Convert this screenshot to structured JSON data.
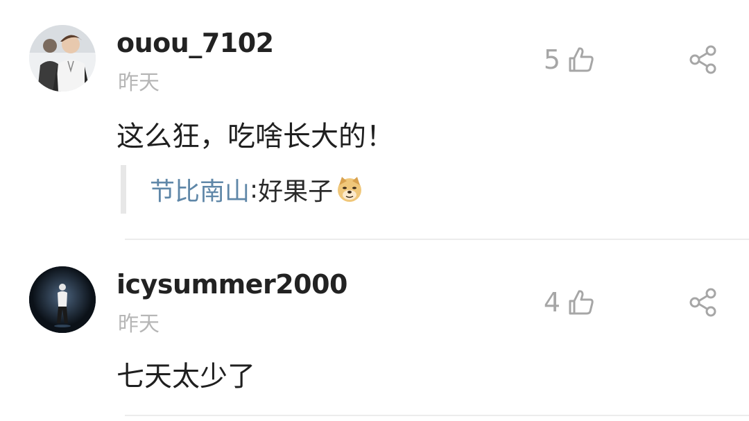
{
  "comments": [
    {
      "username": "ouou_7102",
      "time": "昨天",
      "likes": "5",
      "content": "这么狂，吃啥长大的！",
      "reply": {
        "user": "节比南山",
        "separator": ":",
        "text": "好果子"
      },
      "icons": {
        "like": "thumbs-up-icon",
        "share": "share-icon",
        "emoji": "doge-emoji-icon"
      }
    },
    {
      "username": "icysummer2000",
      "time": "昨天",
      "likes": "4",
      "content": "七天太少了",
      "icons": {
        "like": "thumbs-up-icon",
        "share": "share-icon"
      }
    }
  ],
  "colors": {
    "reply_user": "#5f87a8",
    "muted": "#b6b6b6",
    "text": "#1f1f1f"
  }
}
